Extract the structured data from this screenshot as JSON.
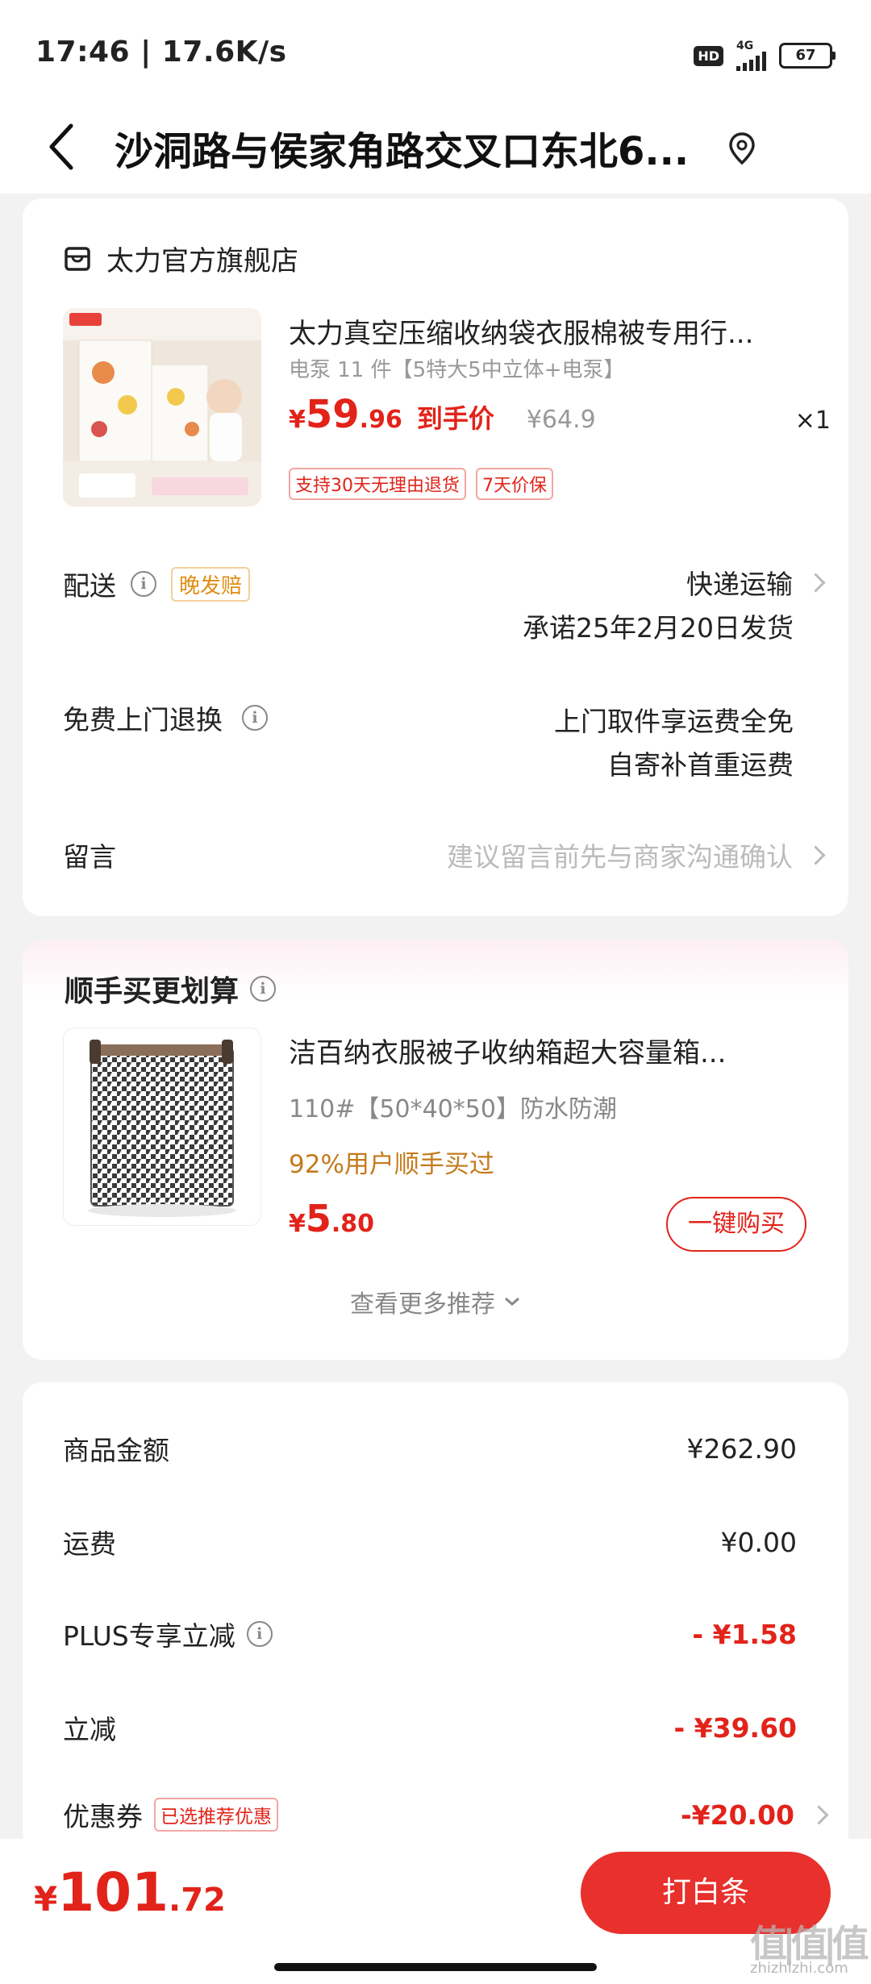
{
  "status_bar": {
    "time": "17:46 | 17.6K/s",
    "hd": "HD",
    "network": "4G",
    "battery": "67"
  },
  "header": {
    "title": "沙洞路与侯家角路交叉口东北6..."
  },
  "shop": {
    "name": "太力官方旗舰店"
  },
  "product": {
    "title": "太力真空压缩收纳袋衣服棉被专用行...",
    "spec": "电泵 11 件【5特大5中立体+电泵】",
    "price_symbol": "¥",
    "price_int": "59",
    "price_dec": ".96",
    "price_label": "到手价",
    "original_price": "¥64.9",
    "quantity": "×1",
    "tags": [
      "支持30天无理由退货",
      "7天价保"
    ]
  },
  "delivery": {
    "label": "配送",
    "tag": "晚发赔",
    "method": "快递运输",
    "promise": "承诺25年2月20日发货"
  },
  "return_service": {
    "label": "免费上门退换",
    "line1": "上门取件享运费全免",
    "line2": "自寄补首重运费"
  },
  "message": {
    "label": "留言",
    "placeholder": "建议留言前先与商家沟通确认"
  },
  "recommend": {
    "title": "顺手买更划算",
    "item_title": "洁百纳衣服被子收纳箱超大容量箱...",
    "item_spec": "110#【50*40*50】防水防潮",
    "buyers": "92%用户顺手买过",
    "price_symbol": "¥",
    "price_int": "5",
    "price_dec": ".80",
    "buy_button": "一键购买",
    "more": "查看更多推荐"
  },
  "fees": {
    "goods_label": "商品金额",
    "goods_value": "¥262.90",
    "shipping_label": "运费",
    "shipping_value": "¥0.00",
    "plus_label": "PLUS专享立减",
    "plus_value": "- ¥1.58",
    "discount_label": "立减",
    "discount_value": "- ¥39.60",
    "coupon_label": "优惠券",
    "coupon_tag": "已选推荐优惠",
    "coupon_value": "-¥20.00"
  },
  "bottom": {
    "price_symbol": "¥",
    "total_int": "101",
    "total_dec": ".72",
    "pay_button": "打白条"
  },
  "watermark": {
    "logo": "值|值|值",
    "site": "zhizhizhi.com"
  }
}
